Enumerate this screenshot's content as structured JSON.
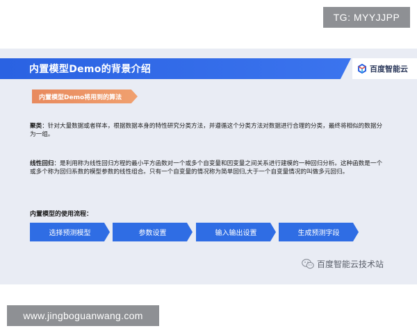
{
  "watermarks": {
    "tg_label": "TG: MYYJJPP",
    "url_label": "www.jingboguanwang.com"
  },
  "slide": {
    "title": "内置模型Demo的背景介绍",
    "brand_name": "百度智能云",
    "section_tag": "内置模型Demo将用到的算法",
    "clustering": {
      "term": "聚类",
      "text": "：针对大量数据或者样本，根据数据本身的特性研究分类方法，并遵循这个分类方法对数据进行合理的分类，最终将相似的数据分为一组。"
    },
    "regression": {
      "term": "线性回归",
      "text": "：是利用称为线性回归方程的最小平方函数对一个或多个自变量和因变量之间关系进行建模的一种回归分析。这种函数是一个或多个称为回归系数的模型参数的线性组合。只有一个自变量的情况称为简单回归,大于一个自变量情况的叫做多元回归。"
    },
    "flow_title": "内置模型的使用流程：",
    "steps": [
      "选择预测模型",
      "参数设置",
      "输入输出设置",
      "生成预测字段"
    ],
    "wechat_label": "百度智能云技术站"
  },
  "colors": {
    "header_blue": "#2a62e2",
    "step_blue": "#2f6de4",
    "tag_orange": "#e88a5e",
    "slide_bg": "#e9ecf4",
    "badge_gray": "#8e9094"
  },
  "icons": {
    "brand": "baidu-cloud-logo-icon",
    "wechat": "wechat-icon"
  }
}
